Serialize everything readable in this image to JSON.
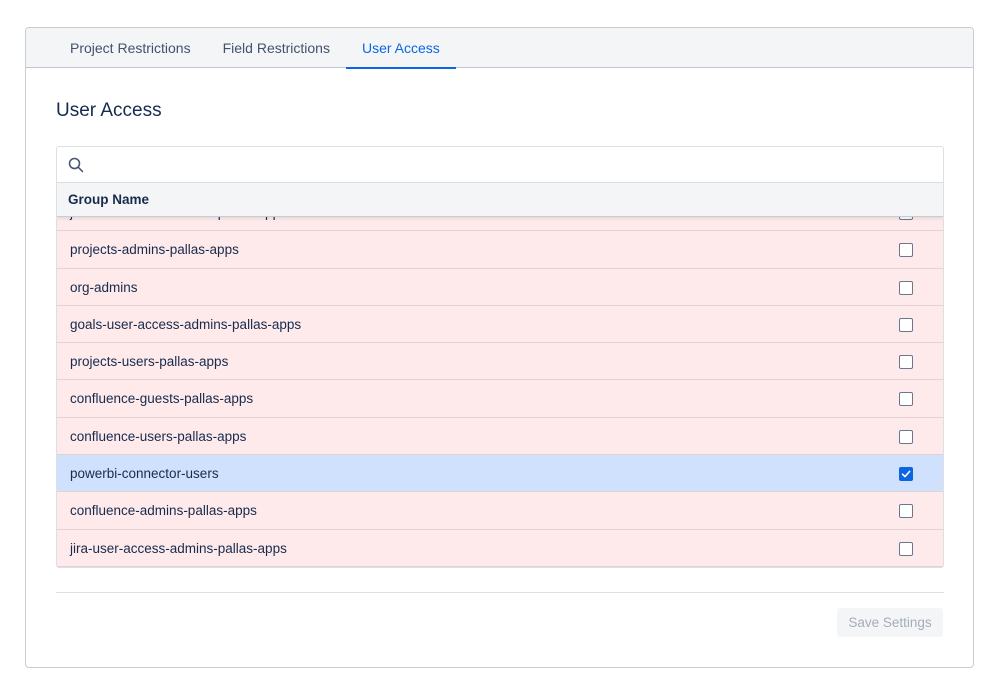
{
  "tabs": [
    {
      "label": "Project Restrictions",
      "active": false
    },
    {
      "label": "Field Restrictions",
      "active": false
    },
    {
      "label": "User Access",
      "active": true
    }
  ],
  "page_title": "User Access",
  "search": {
    "value": "",
    "icon": "search-icon"
  },
  "table": {
    "header": "Group Name",
    "rows": [
      {
        "name": "jira-user-access-admins-pallas-apps",
        "checked": false,
        "partially_hidden": true
      },
      {
        "name": "projects-admins-pallas-apps",
        "checked": false
      },
      {
        "name": "org-admins",
        "checked": false
      },
      {
        "name": "goals-user-access-admins-pallas-apps",
        "checked": false
      },
      {
        "name": "projects-users-pallas-apps",
        "checked": false
      },
      {
        "name": "confluence-guests-pallas-apps",
        "checked": false
      },
      {
        "name": "confluence-users-pallas-apps",
        "checked": false
      },
      {
        "name": "powerbi-connector-users",
        "checked": true
      },
      {
        "name": "confluence-admins-pallas-apps",
        "checked": false
      },
      {
        "name": "jira-user-access-admins-pallas-apps",
        "checked": false
      }
    ]
  },
  "save_button": {
    "label": "Save Settings",
    "disabled": true
  },
  "colors": {
    "accent": "#0c66e4",
    "row_unchecked_bg": "#feeaea",
    "row_checked_bg": "#cfe1fd"
  }
}
